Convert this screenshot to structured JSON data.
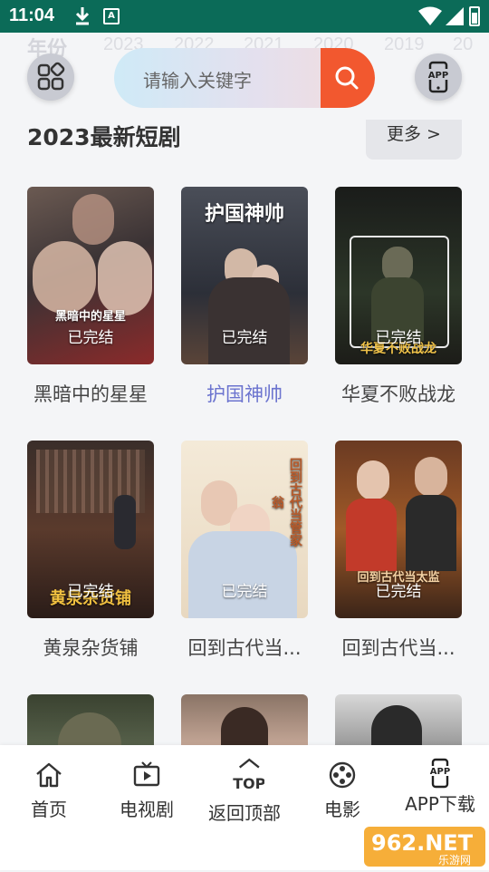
{
  "status_bar": {
    "time": "11:04",
    "apk_label": "A"
  },
  "year_filter": {
    "label": "年份",
    "years": [
      "2023",
      "2022",
      "2021",
      "2020",
      "2019",
      "20"
    ]
  },
  "header": {
    "search_placeholder": "请输入关键字",
    "app_button_label": "APP",
    "search_button_color": "#f2582f"
  },
  "section": {
    "title": "2023最新短剧",
    "more_label": "更多 >"
  },
  "cards": [
    {
      "name": "黑暗中的星星",
      "status": "已完结",
      "poster_title": "黑暗中的星星"
    },
    {
      "name": "护国神帅",
      "status": "已完结",
      "poster_title": "护国神帅"
    },
    {
      "name": "华夏不败战龙",
      "status": "已完结",
      "poster_title": "华夏不败战龙"
    },
    {
      "name": "黄泉杂货铺",
      "status": "已完结",
      "poster_title": "黄泉杂货铺"
    },
    {
      "name": "回到古代当...",
      "status": "已完结",
      "poster_title": "回到古代当管家翁"
    },
    {
      "name": "回到古代当...",
      "status": "已完结",
      "poster_title": "回到古代当太监"
    }
  ],
  "bottom_nav": [
    {
      "label": "首页",
      "icon": "home-icon"
    },
    {
      "label": "电视剧",
      "icon": "tv-icon"
    },
    {
      "label": "返回顶部",
      "icon": "top-icon",
      "icon_text": "TOP"
    },
    {
      "label": "电影",
      "icon": "film-reel-icon"
    },
    {
      "label": "APP下载",
      "icon": "app-download-icon",
      "icon_text": "APP"
    }
  ],
  "watermark": {
    "text": "962.NET",
    "subtext": "乐游网"
  },
  "colors": {
    "status_bar": "#0b6b58",
    "accent": "#f2582f",
    "active_link": "#6c74cf"
  }
}
